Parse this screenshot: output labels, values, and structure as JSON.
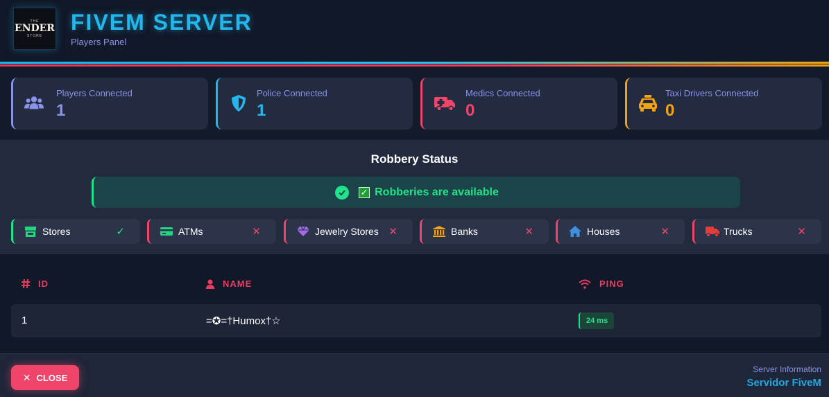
{
  "header": {
    "logo_small_top": "THE",
    "logo_text": "ENDER",
    "logo_small_bottom": "STORE",
    "title": "FIVEM SERVER",
    "subtitle": "Players Panel"
  },
  "stats": [
    {
      "label": "Players Connected",
      "value": "1",
      "icon": "users-icon",
      "color": "#8b93e8"
    },
    {
      "label": "Police Connected",
      "value": "1",
      "icon": "shield-icon",
      "color": "#23b7ee"
    },
    {
      "label": "Medics Connected",
      "value": "0",
      "icon": "ambulance-icon",
      "color": "#f0456a"
    },
    {
      "label": "Taxi Drivers Connected",
      "value": "0",
      "icon": "taxi-icon",
      "color": "#f5a312"
    }
  ],
  "robbery": {
    "title": "Robbery Status",
    "status_text": "Robberies are available",
    "items": [
      {
        "label": "Stores",
        "status": "✓",
        "available": true,
        "icon": "store-icon",
        "icon_color": "#1fd87f"
      },
      {
        "label": "ATMs",
        "status": "✕",
        "available": false,
        "icon": "atm-card-icon",
        "icon_color": "#1fd87f"
      },
      {
        "label": "Jewelry Stores",
        "status": "✕",
        "available": false,
        "icon": "gem-icon",
        "icon_color": "#a46be8"
      },
      {
        "label": "Banks",
        "status": "✕",
        "available": false,
        "icon": "bank-icon",
        "icon_color": "#f5a312"
      },
      {
        "label": "Houses",
        "status": "✕",
        "available": false,
        "icon": "house-icon",
        "icon_color": "#3f8fe0"
      },
      {
        "label": "Trucks",
        "status": "✕",
        "available": false,
        "icon": "truck-icon",
        "icon_color": "#e23d3d"
      }
    ]
  },
  "table": {
    "columns": [
      {
        "label": "ID",
        "icon": "hash-icon"
      },
      {
        "label": "NAME",
        "icon": "user-icon"
      },
      {
        "label": "PING",
        "icon": "wifi-icon"
      }
    ],
    "rows": [
      {
        "id": "1",
        "name": "=✪=†Humox†☆",
        "ping": "24 ms"
      }
    ]
  },
  "footer": {
    "close_label": "CLOSE",
    "info_label": "Server Information",
    "info_value": "Servidor FiveM"
  }
}
